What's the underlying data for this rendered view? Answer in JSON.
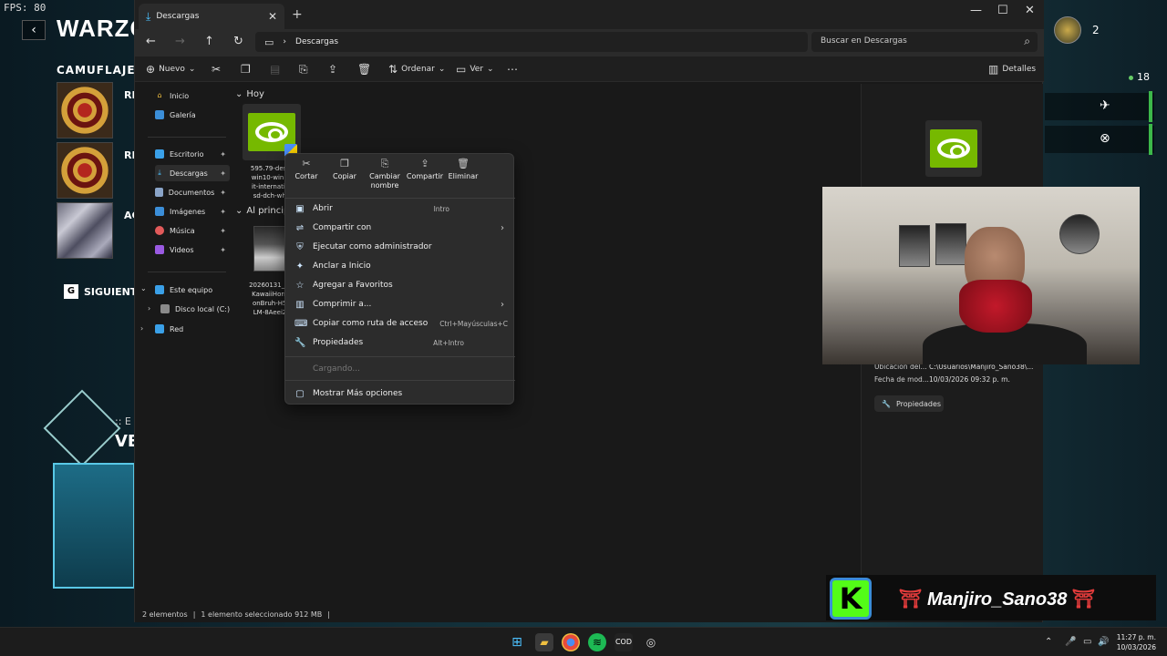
{
  "game": {
    "fps_label": "FPS: 80",
    "title": "WARZO",
    "section": "CAMUFLAJES",
    "camos": [
      {
        "code": "RE"
      },
      {
        "code": "RE"
      },
      {
        "code": "AC"
      }
    ],
    "next_key": "G",
    "next_label": "SIGUIENTE",
    "emblem_small": ":: E",
    "emblem_big": "VE",
    "right_count": "2",
    "online_count": "18"
  },
  "window": {
    "tab_title": "Descargas",
    "breadcrumb": "Descargas",
    "search_placeholder": "Buscar en Descargas"
  },
  "toolbar": {
    "new_label": "Nuevo",
    "sort_label": "Ordenar",
    "view_label": "Ver",
    "details_label": "Detalles"
  },
  "sidebar": {
    "items": [
      {
        "label": "Inicio"
      },
      {
        "label": "Galería"
      },
      {
        "label": "Escritorio"
      },
      {
        "label": "Descargas"
      },
      {
        "label": "Documentos"
      },
      {
        "label": "Imágenes"
      },
      {
        "label": "Música"
      },
      {
        "label": "Videos"
      },
      {
        "label": "Este equipo"
      },
      {
        "label": "Disco local (C:)"
      },
      {
        "label": "Red"
      }
    ]
  },
  "content": {
    "group_today": "Hoy",
    "group_earlier": "Al principi",
    "file1_name": "595.79-deskt\nwin10-win11\nit-internatior\nsd-dch-whq",
    "file2_name": "20260131_Sle\nKawaiiHorne\nonBruh-H5-I\nLM-8AeeiZ_"
  },
  "details": {
    "rows": [
      {
        "k": "Ubicación del...",
        "v": "C:\\Usuarios\\Manjiro_Sano38\\..."
      },
      {
        "k": "Fecha de mod...",
        "v": "10/03/2026 09:32 p. m."
      }
    ],
    "props_button": "Propiedades"
  },
  "status": {
    "count": "2 elementos",
    "sep": "|",
    "selected": "1 elemento seleccionado 912 MB",
    "sep2": "|"
  },
  "context_menu": {
    "quick": [
      {
        "label": "Cortar"
      },
      {
        "label": "Copiar"
      },
      {
        "label": "Cambiar\nnombre"
      },
      {
        "label": "Compartir"
      },
      {
        "label": "Eliminar"
      }
    ],
    "items": [
      {
        "label": "Abrir",
        "shortcut": "Intro"
      },
      {
        "label": "Compartir con"
      },
      {
        "label": "Ejecutar como administrador"
      },
      {
        "label": "Anclar a Inicio"
      },
      {
        "label": "Agregar a Favoritos"
      },
      {
        "label": "Comprimir a..."
      },
      {
        "label": "Copiar como ruta de acceso",
        "shortcut": "Ctrl+Mayúsculas+C"
      },
      {
        "label": "Propiedades",
        "shortcut": "Alt+Intro"
      }
    ],
    "loading": "Cargando...",
    "more": "Mostrar Más opciones"
  },
  "banner": {
    "logo_letter": "K",
    "torii": "⛩",
    "name": "Manjiro_Sano38"
  },
  "taskbar": {
    "time": "11:27 p. m.",
    "date": "10/03/2026"
  }
}
